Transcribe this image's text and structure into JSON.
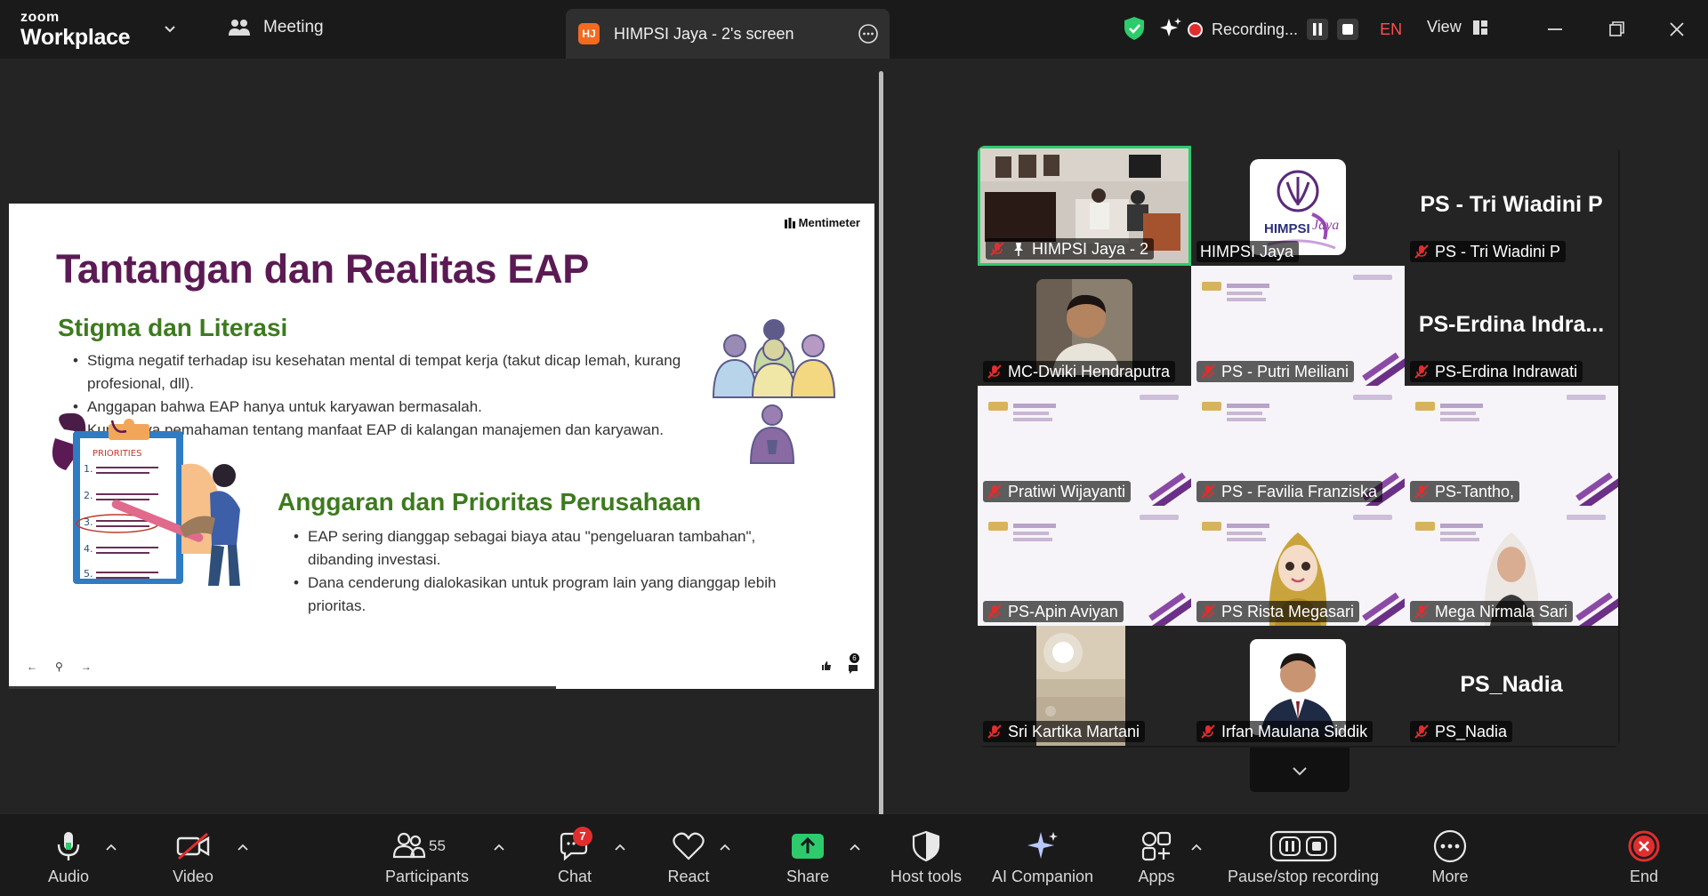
{
  "app": {
    "brand_small": "zoom",
    "brand_big": "Workplace",
    "meeting_tab": "Meeting",
    "share_tab": {
      "initials": "HJ",
      "label": "HIMPSI Jaya - 2's screen"
    },
    "recording_label": "Recording...",
    "language": "EN",
    "view_label": "View",
    "accent_green": "#2dcb6b",
    "rec_red": "#e02e2e"
  },
  "slide": {
    "brand": "Mentimeter",
    "title": "Tantangan dan Realitas EAP",
    "section1": {
      "heading": "Stigma dan Literasi",
      "bullets": [
        "Stigma negatif terhadap isu kesehatan mental di tempat kerja (takut dicap lemah, kurang profesional, dll).",
        "Anggapan bahwa EAP hanya untuk karyawan bermasalah.",
        "Kurangnya pemahaman tentang manfaat EAP di kalangan manajemen dan karyawan."
      ]
    },
    "section2": {
      "heading": "Anggaran dan Prioritas Perusahaan",
      "bullets": [
        "EAP sering dianggap sebagai biaya atau \"pengeluaran tambahan\", dibanding investasi.",
        "Dana cenderung dialokasikan untuk program lain yang dianggap lebih prioritas."
      ]
    },
    "priorities_label": "PRIORITIES",
    "priorities_numbers": [
      "1.",
      "2.",
      "3.",
      "4.",
      "5."
    ],
    "nav": {
      "prev": "←",
      "pin": "⚲",
      "next": "→"
    },
    "react_count": "6"
  },
  "gallery": {
    "tiles": [
      {
        "name": "HIMPSI Jaya - 2",
        "kind": "video-room",
        "active": true,
        "pinned": true
      },
      {
        "name": "HIMPSI Jaya",
        "kind": "logo",
        "logo_text": "HIMPSI",
        "logo_script": "Jaya"
      },
      {
        "name": "PS - Tri Wiadini P",
        "kind": "text",
        "big": "PS - Tri Wiadini P"
      },
      {
        "name": "MC-Dwiki Hendraputra",
        "kind": "photo-man"
      },
      {
        "name": "PS - Putri Meiliani",
        "kind": "slide"
      },
      {
        "name": "PS-Erdina Indrawati",
        "kind": "text",
        "big": "PS-Erdina  Indra..."
      },
      {
        "name": "Pratiwi Wijayanti",
        "kind": "slide"
      },
      {
        "name": "PS - Favilia Franziska",
        "kind": "slide"
      },
      {
        "name": "PS-Tantho,",
        "kind": "slide"
      },
      {
        "name": "PS-Apin Aviyan",
        "kind": "slide"
      },
      {
        "name": "PS Rista Megasari",
        "kind": "slide-avatar"
      },
      {
        "name": "Mega Nirmala Sari",
        "kind": "slide-person"
      },
      {
        "name": "Sri Kartika Martani",
        "kind": "photo-light"
      },
      {
        "name": "Irfan Maulana Siddik",
        "kind": "photo-suit"
      },
      {
        "name": "PS_Nadia",
        "kind": "text",
        "big": "PS_Nadia"
      }
    ]
  },
  "toolbar": {
    "audio": "Audio",
    "video": "Video",
    "participants": "Participants",
    "participants_count": "55",
    "chat": "Chat",
    "chat_badge": "7",
    "react": "React",
    "share": "Share",
    "host_tools": "Host tools",
    "ai_companion": "AI Companion",
    "apps": "Apps",
    "pause_recording": "Pause/stop recording",
    "more": "More",
    "end": "End"
  }
}
